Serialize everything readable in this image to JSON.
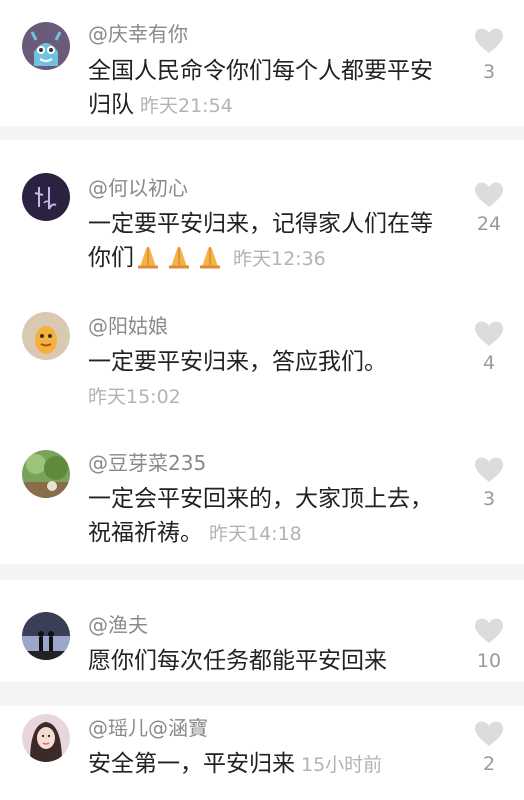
{
  "comments": [
    {
      "username": "@庆幸有你",
      "text": "全国人民命令你们每个人都要平安归队",
      "time": "昨天21:54",
      "likes": "3",
      "avatar": "monster-avatar-icon"
    },
    {
      "username": "@何以初心",
      "text": "一定要平安归来，记得家人们在等你们",
      "emoji": "🙏🙏🙏",
      "time": "昨天12:36",
      "likes": "24",
      "avatar": "calligraphy-avatar-icon"
    },
    {
      "username": "@阳姑娘",
      "text": "一定要平安归来，答应我们。",
      "time": "昨天15:02",
      "likes": "4",
      "avatar": "cartoon-face-avatar-icon"
    },
    {
      "username": "@豆芽菜235",
      "text": "一定会平安回来的，大家顶上去，祝福祈祷。",
      "time": "昨天14:18",
      "likes": "3",
      "avatar": "landscape-avatar-icon"
    },
    {
      "username": "@渔夫",
      "text": "愿你们每次任务都能平安回来",
      "time": "",
      "likes": "10",
      "avatar": "couple-silhouette-avatar-icon"
    },
    {
      "username": "@瑶儿@涵寶",
      "text": "安全第一，平安归来",
      "time": "15小时前",
      "likes": "2",
      "avatar": "portrait-avatar-icon"
    }
  ],
  "colors": {
    "background": "#f4f4f4",
    "card": "#ffffff",
    "username": "#8a8a8a",
    "text": "#222222",
    "time": "#b3b3b3",
    "heart": "#dcdcdc"
  },
  "icons": {
    "like": "heart-icon",
    "emoji": "folded-hands-emoji"
  }
}
